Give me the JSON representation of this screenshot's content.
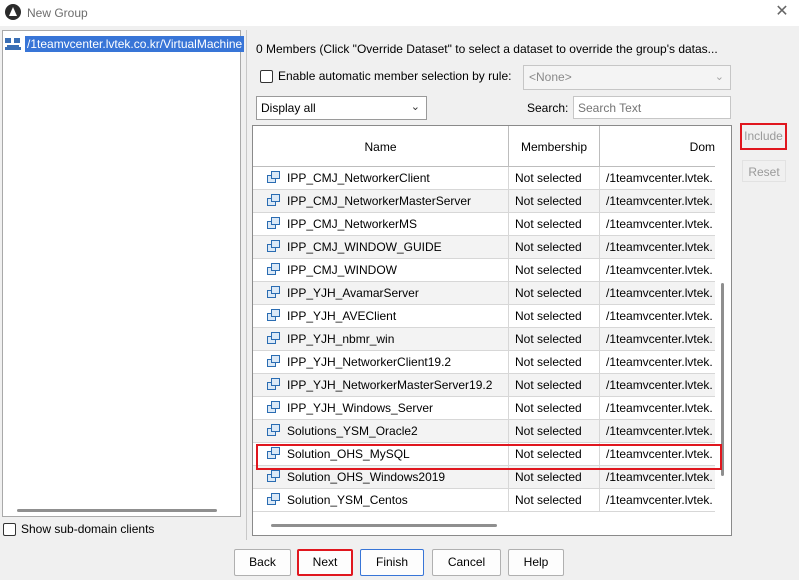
{
  "window": {
    "title": "New Group",
    "close_glyph": "✕"
  },
  "left_panel": {
    "tree_item_label": "/1teamvcenter.lvtek.co.kr/VirtualMachine",
    "show_subdomain_label": "Show sub-domain clients"
  },
  "right_panel": {
    "members_text": "0 Members (Click \"Override Dataset\" to select a dataset to override the group's datas...",
    "auto_rule_label": "Enable automatic member selection by rule:",
    "rule_select_value": "<None>",
    "display_select_value": "Display all",
    "search_label": "Search:",
    "search_placeholder": "Search Text"
  },
  "table": {
    "columns": [
      "Name",
      "Membership",
      "Dom"
    ],
    "rows": [
      {
        "name": "IPP_CMJ_NetworkerClient",
        "membership": "Not selected",
        "domain": "/1teamvcenter.lvtek."
      },
      {
        "name": "IPP_CMJ_NetworkerMasterServer",
        "membership": "Not selected",
        "domain": "/1teamvcenter.lvtek."
      },
      {
        "name": "IPP_CMJ_NetworkerMS",
        "membership": "Not selected",
        "domain": "/1teamvcenter.lvtek."
      },
      {
        "name": "IPP_CMJ_WINDOW_GUIDE",
        "membership": "Not selected",
        "domain": "/1teamvcenter.lvtek."
      },
      {
        "name": "IPP_CMJ_WINDOW",
        "membership": "Not selected",
        "domain": "/1teamvcenter.lvtek."
      },
      {
        "name": "IPP_YJH_AvamarServer",
        "membership": "Not selected",
        "domain": "/1teamvcenter.lvtek."
      },
      {
        "name": "IPP_YJH_AVEClient",
        "membership": "Not selected",
        "domain": "/1teamvcenter.lvtek."
      },
      {
        "name": "IPP_YJH_nbmr_win",
        "membership": "Not selected",
        "domain": "/1teamvcenter.lvtek."
      },
      {
        "name": "IPP_YJH_NetworkerClient19.2",
        "membership": "Not selected",
        "domain": "/1teamvcenter.lvtek."
      },
      {
        "name": "IPP_YJH_NetworkerMasterServer19.2",
        "membership": "Not selected",
        "domain": "/1teamvcenter.lvtek."
      },
      {
        "name": "IPP_YJH_Windows_Server",
        "membership": "Not selected",
        "domain": "/1teamvcenter.lvtek."
      },
      {
        "name": "Solutions_YSM_Oracle2",
        "membership": "Not selected",
        "domain": "/1teamvcenter.lvtek."
      },
      {
        "name": "Solution_OHS_MySQL",
        "membership": "Not selected",
        "domain": "/1teamvcenter.lvtek."
      },
      {
        "name": "Solution_OHS_Windows2019",
        "membership": "Not selected",
        "domain": "/1teamvcenter.lvtek."
      },
      {
        "name": "Solution_YSM_Centos",
        "membership": "Not selected",
        "domain": "/1teamvcenter.lvtek."
      }
    ],
    "highlighted_row": "IPP_YJH_NetworkerClient19.2"
  },
  "side_buttons": {
    "include": "Include",
    "reset": "Reset"
  },
  "bottom_buttons": {
    "back": "Back",
    "next": "Next",
    "finish": "Finish",
    "cancel": "Cancel",
    "help": "Help"
  },
  "colors": {
    "highlight_border": "#e0161e",
    "selection_bg": "#3875d7"
  },
  "icons": [
    "app-logo-icon",
    "close-icon",
    "network-tree-icon",
    "virtual-machine-icon",
    "chevron-down-icon"
  ]
}
